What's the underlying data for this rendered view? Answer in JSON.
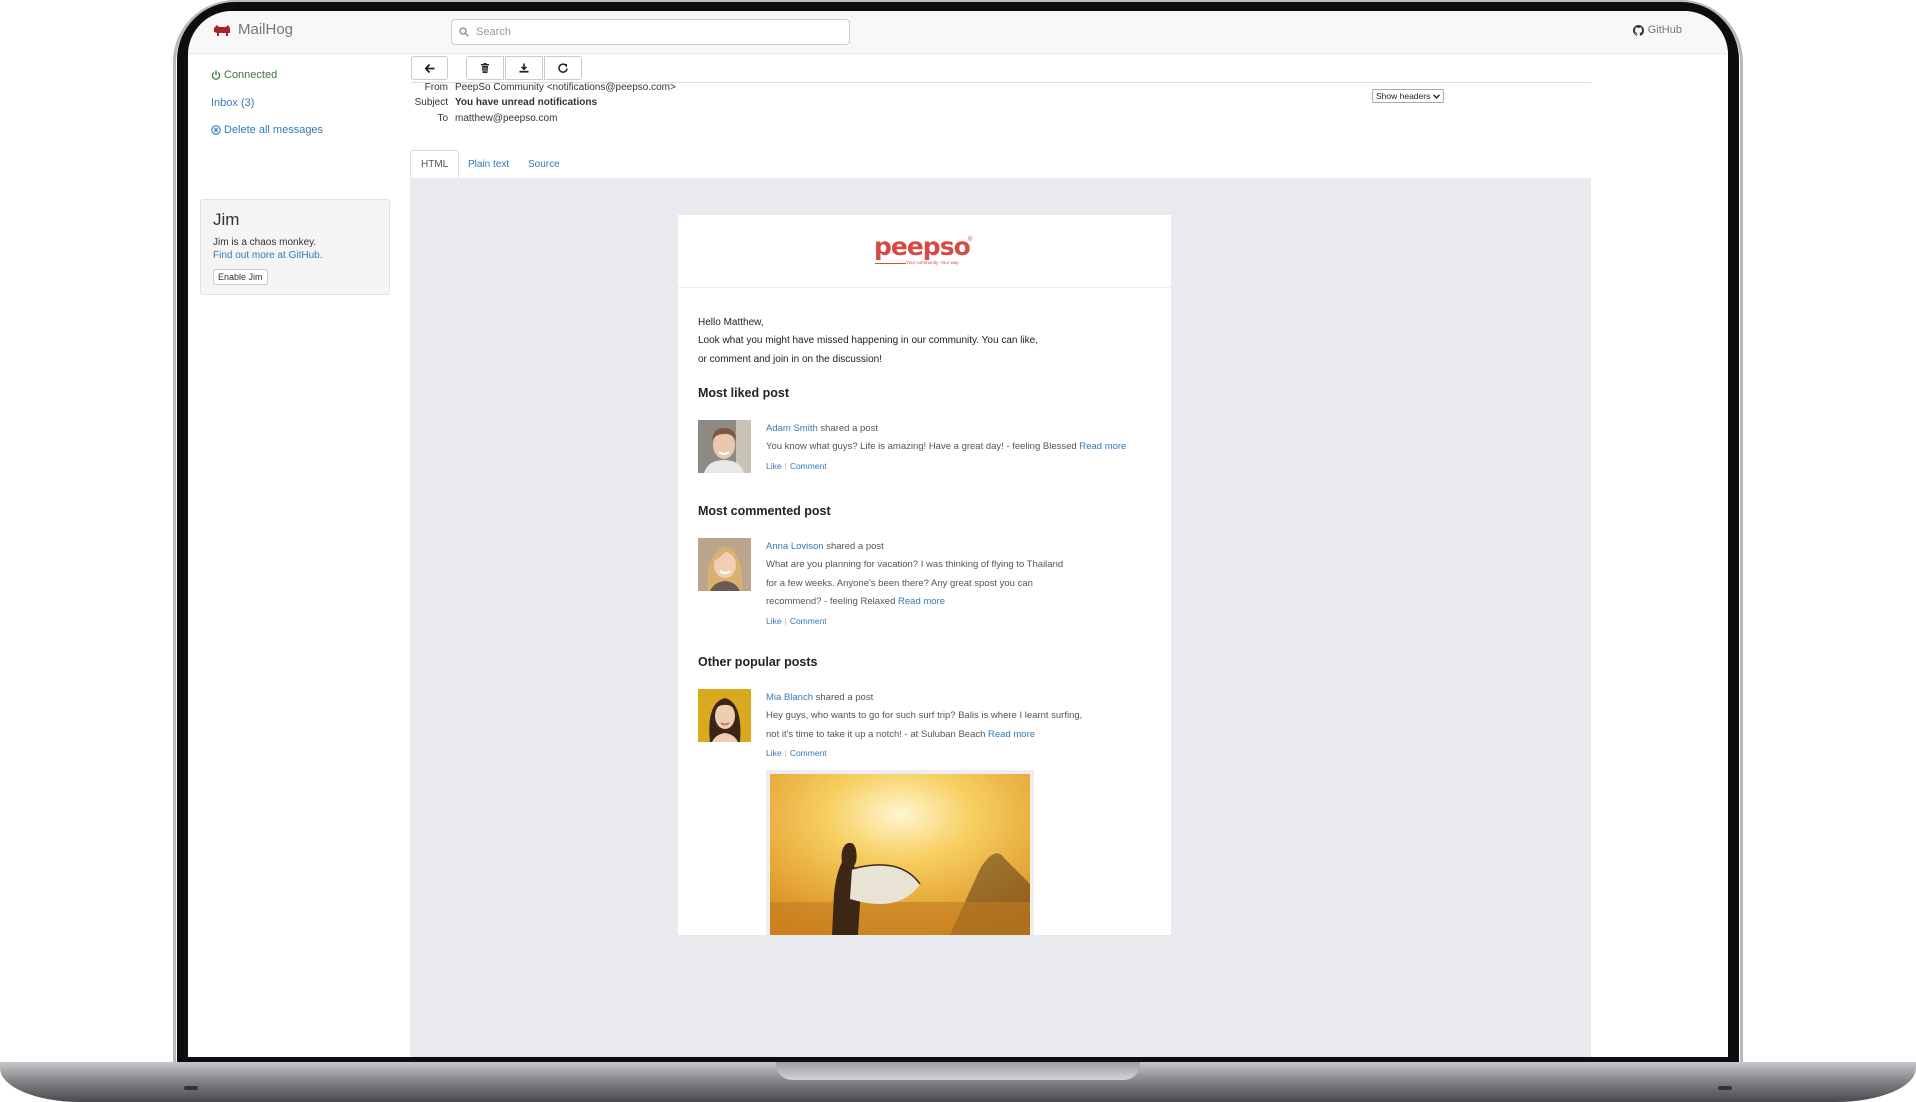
{
  "app": {
    "brand": "MailHog",
    "github_label": "GitHub"
  },
  "search": {
    "placeholder": "Search"
  },
  "sidebar": {
    "connected": "Connected",
    "inbox": "Inbox (3)",
    "delete_all": "Delete all messages",
    "jim": {
      "title": "Jim",
      "description": "Jim is a chaos monkey.",
      "link": "Find out more at GitHub.",
      "button": "Enable Jim"
    }
  },
  "toolbar": {
    "back": "back-icon",
    "delete": "trash-icon",
    "download": "download-icon",
    "release": "release-icon"
  },
  "message": {
    "from_label": "From",
    "from": "PeepSo Community <notifications@peepso.com>",
    "subject_label": "Subject",
    "subject": "You have unread notifications",
    "to_label": "To",
    "to": "matthew@peepso.com",
    "show_headers": "Show headers"
  },
  "tabs": [
    {
      "label": "HTML"
    },
    {
      "label": "Plain text"
    },
    {
      "label": "Source"
    }
  ],
  "email": {
    "logo": "peepso",
    "logo_reg": "®",
    "tagline": "Your community. Your way.",
    "greeting": "Hello Matthew,",
    "intro1": "Look what you might have missed happening in our community. You can like,",
    "intro2": "or comment and join in on the discussion!",
    "sections": [
      {
        "title": "Most liked post",
        "author": "Adam Smith",
        "shared": "shared a post",
        "lines": [
          "You know what guys? Life is amazing! Have a great day! - feeling Blessed"
        ],
        "read_more": "Read more",
        "like": "Like",
        "comment": "Comment"
      },
      {
        "title": "Most commented post",
        "author": "Anna Lovison",
        "shared": "shared a post",
        "lines": [
          "What are you planning for vacation? I was thinking of flying to Thailand",
          "for a few weeks. Anyone's been there? Any great spost you can",
          "recommend? - feeling Relaxed"
        ],
        "read_more": "Read more",
        "like": "Like",
        "comment": "Comment"
      },
      {
        "title": "Other popular posts",
        "author": "Mia Blanch",
        "shared": "shared a post",
        "lines": [
          "Hey guys, who wants to go for such surf trip? Balis is where I learnt surfing,",
          "not it's time to take it up a notch! - at Suluban Beach"
        ],
        "read_more": "Read more",
        "like": "Like",
        "comment": "Comment"
      }
    ]
  },
  "colors": {
    "link": "#337ab7",
    "brand_red": "#d44a45",
    "connected": "#3c763d",
    "preview_bg": "#e9eaed"
  }
}
